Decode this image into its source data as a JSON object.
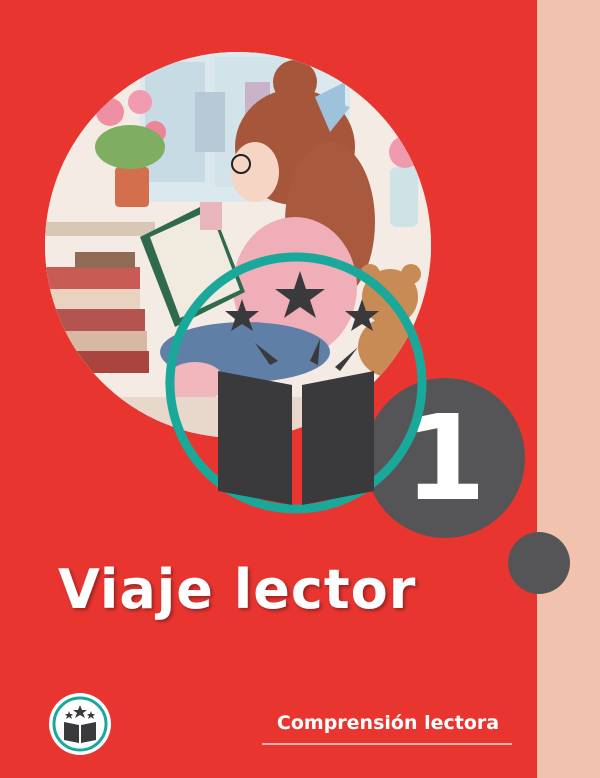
{
  "cover": {
    "title": "Viaje lector",
    "subtitle": "Comprensión lectora",
    "volume_number": "1"
  },
  "illustration": {
    "description_icon": "girl-reading-illustration",
    "emblem_icon": "open-book-stars-icon",
    "logo_icon": "book-stars-logo-icon"
  },
  "colors": {
    "background": "#e83530",
    "side_strip": "#f1c2ad",
    "badge": "#555557",
    "emblem_ring": "#1aa89a",
    "emblem_dark": "#3a3a3c"
  }
}
